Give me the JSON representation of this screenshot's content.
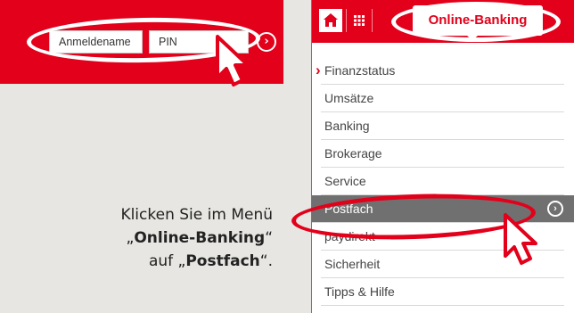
{
  "login": {
    "username_placeholder": "Anmeldename",
    "pin_placeholder": "PIN",
    "go_symbol": "›"
  },
  "instruction": {
    "line1": "Klicken Sie im Menü",
    "line2_open": "„",
    "line2_bold": "Online-Banking",
    "line2_close": "“",
    "line3_prefix": "auf „",
    "line3_bold": "Postfach",
    "line3_suffix": "“."
  },
  "topbar": {
    "home_icon": "home-icon",
    "grid_icon": "grid-icon",
    "active_tab": "Online-Banking"
  },
  "menu": {
    "items": [
      "Finanzstatus",
      "Umsätze",
      "Banking",
      "Brokerage",
      "Service",
      "Postfach",
      "paydirekt",
      "Sicherheit",
      "Tipps & Hilfe"
    ],
    "go_symbol": "›"
  },
  "colors": {
    "brand_red": "#e2001a",
    "highlight_gray": "#707070",
    "panel_bg": "#e8e6e2"
  }
}
